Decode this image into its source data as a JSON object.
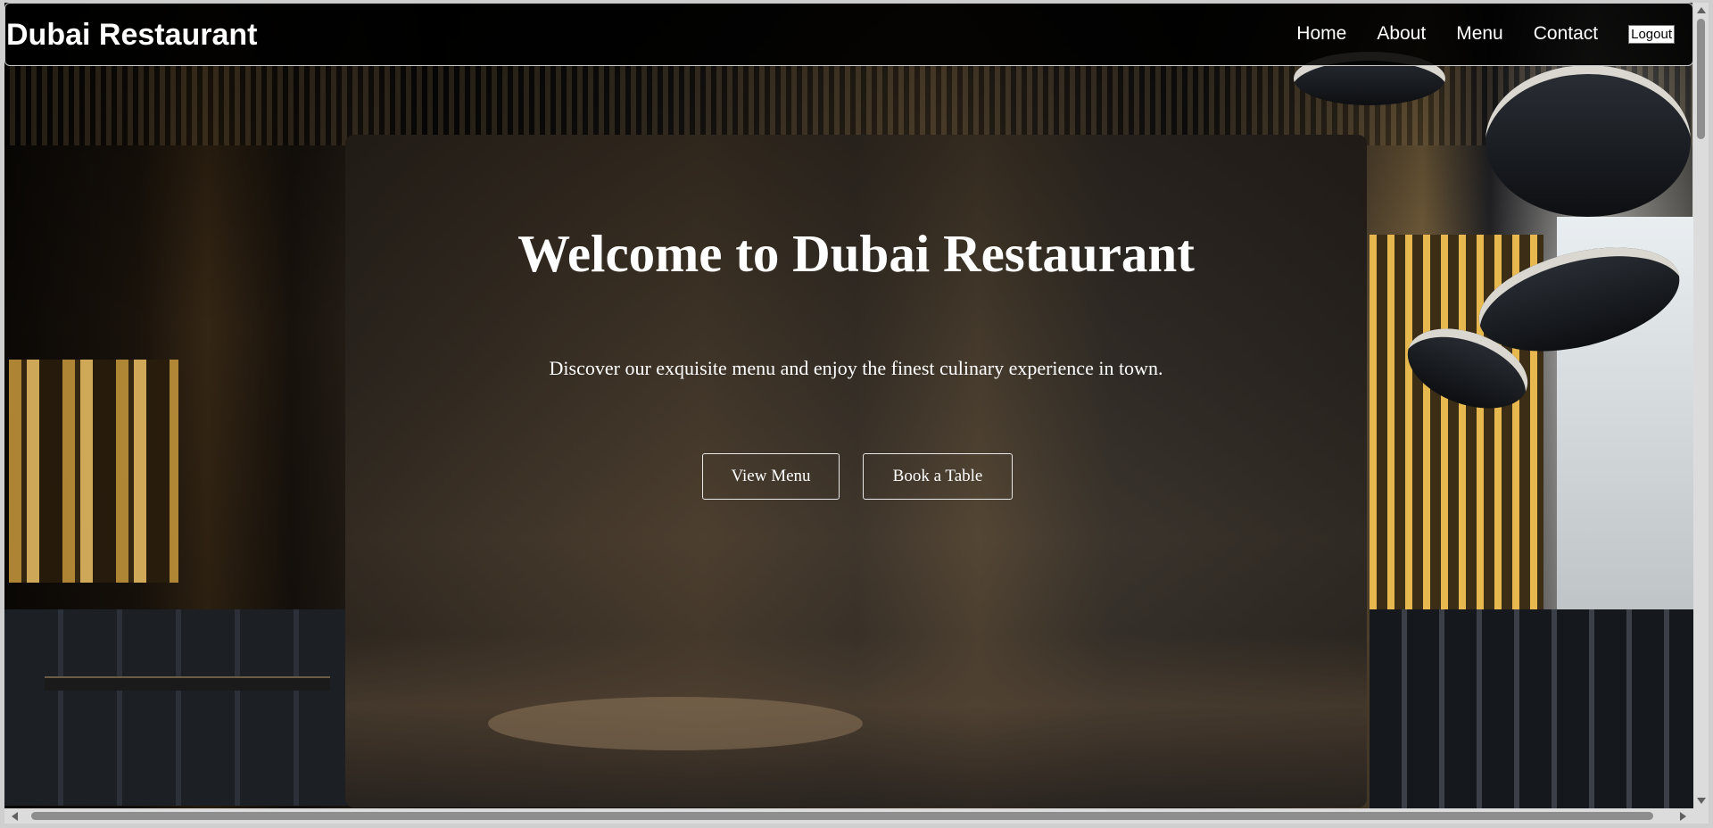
{
  "header": {
    "brand": "Dubai Restaurant",
    "nav": [
      {
        "label": "Home"
      },
      {
        "label": "About"
      },
      {
        "label": "Menu"
      },
      {
        "label": "Contact"
      }
    ],
    "logout_label": "Logout"
  },
  "hero": {
    "title": "Welcome to Dubai Restaurant",
    "subtitle": "Discover our exquisite menu and enjoy the finest culinary experience in town.",
    "buttons": {
      "view_menu": "View Menu",
      "book_table": "Book a Table"
    },
    "background": "restaurant-interior-photo"
  },
  "colors": {
    "nav_background": "#000000",
    "text": "#ffffff",
    "button_border": "#e8e8e8"
  }
}
